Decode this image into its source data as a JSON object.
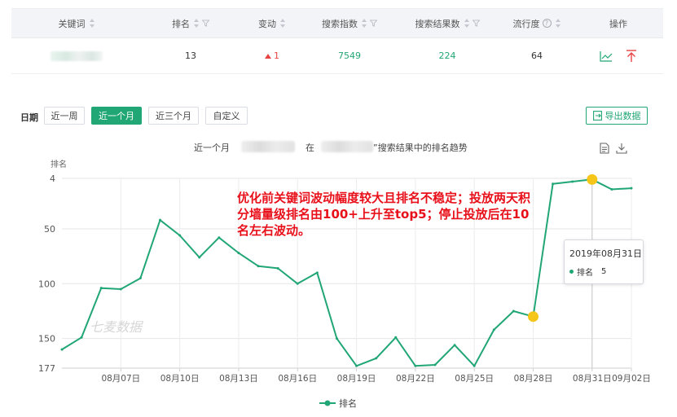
{
  "table": {
    "headers": {
      "keyword": "关键词",
      "rank": "排名",
      "change": "变动",
      "search_index": "搜索指数",
      "result_count": "搜索结果数",
      "popularity": "流行度",
      "action": "操作"
    },
    "row": {
      "rank": "13",
      "change": "1",
      "search_index": "7549",
      "result_count": "224",
      "popularity": "64"
    }
  },
  "date_filter": {
    "label": "日期",
    "buttons": [
      "近一周",
      "近一个月",
      "近三个月",
      "自定义"
    ],
    "active": "近一个月"
  },
  "export_label": "导出数据",
  "chart_header": {
    "prefix": "近一个月",
    "middle": "在",
    "suffix": "”搜索结果中的排名趋势"
  },
  "annotation": "优化前关键词波动幅度较大且排名不稳定；投放两天积分墙量级排名由100+上升至top5；停止投放后在10名左右波动。",
  "tooltip": {
    "date": "2019年08月31日",
    "series": "排名",
    "value": "5"
  },
  "watermark": "七麦数据",
  "colors": {
    "accent": "#21a675",
    "rise": "#e84343",
    "highlight": "#f5c518",
    "annotation": "#e8101a"
  },
  "chart_data": {
    "type": "line",
    "ylabel": "排名",
    "y_inverted": true,
    "ylim": [
      4,
      177
    ],
    "y_ticks": [
      4,
      50,
      100,
      150,
      177
    ],
    "x_ticks": [
      "08月07日",
      "08月10日",
      "08月13日",
      "08月16日",
      "08月19日",
      "08月22日",
      "08月25日",
      "08月28日",
      "08月31日",
      "09月02日"
    ],
    "series": [
      {
        "name": "排名",
        "x": [
          "08月04日",
          "08月05日",
          "08月06日",
          "08月07日",
          "08月08日",
          "08月09日",
          "08月10日",
          "08月11日",
          "08月12日",
          "08月13日",
          "08月14日",
          "08月15日",
          "08月16日",
          "08月17日",
          "08月18日",
          "08月19日",
          "08月20日",
          "08月21日",
          "08月22日",
          "08月23日",
          "08月24日",
          "08月25日",
          "08月26日",
          "08月27日",
          "08月28日",
          "08月29日",
          "08月30日",
          "08月31日",
          "09月01日",
          "09月02日"
        ],
        "values": [
          160,
          149,
          104,
          105,
          95,
          42,
          56,
          76,
          58,
          72,
          84,
          86,
          100,
          90,
          150,
          175,
          168,
          149,
          175,
          174,
          156,
          175,
          142,
          125,
          130,
          9,
          7,
          5,
          14,
          13
        ]
      }
    ],
    "highlighted_points": [
      "08月28日",
      "08月31日"
    ],
    "legend": "bottom-center",
    "grid": true
  }
}
